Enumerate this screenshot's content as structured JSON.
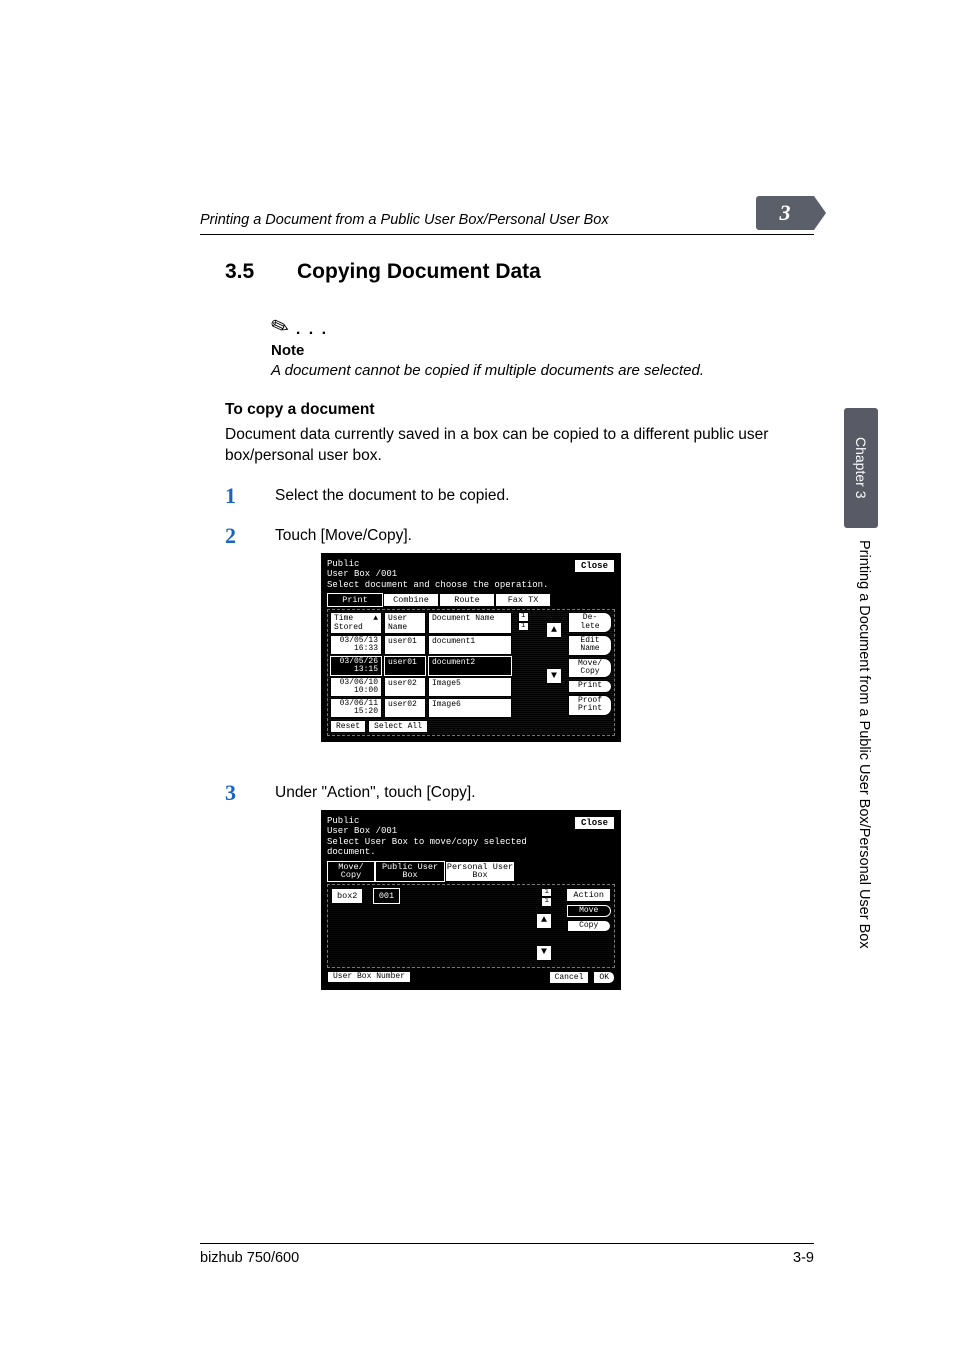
{
  "header": {
    "running": "Printing a Document from a Public User Box/Personal User Box",
    "chapter_badge": "3"
  },
  "side": {
    "chapter": "Chapter 3",
    "long": "Printing a Document from a Public User Box/Personal User Box"
  },
  "section": {
    "number": "3.5",
    "title": "Copying Document Data"
  },
  "note": {
    "label": "Note",
    "text": "A document cannot be copied if multiple documents are selected."
  },
  "sub": {
    "heading": "To copy a document",
    "intro": "Document data currently saved in a box can be copied to a different public user box/personal user box."
  },
  "steps": {
    "s1": {
      "n": "1",
      "t": "Select the document to be copied."
    },
    "s2": {
      "n": "2",
      "t": "Touch [Move/Copy]."
    },
    "s3": {
      "n": "3",
      "t": "Under \"Action\", touch [Copy]."
    }
  },
  "panel1": {
    "title_l1": "Public",
    "title_l2": "User Box   /001",
    "subtitle": "Select document and choose the operation.",
    "close": "Close",
    "tabs": {
      "print": "Print",
      "combine": "Combine",
      "route": "Route",
      "fax": "Fax TX"
    },
    "cols": {
      "time": "Time Stored",
      "sort_glyph": "▲",
      "user": "User Name",
      "doc": "Document Name"
    },
    "count": {
      "top": "1",
      "bot": "1"
    },
    "rows": [
      {
        "date": "03/05/13 16:33",
        "user": "user01",
        "doc": "document1"
      },
      {
        "date": "03/05/26 13:15",
        "user": "user01",
        "doc": "document2",
        "selected": true
      },
      {
        "date": "03/06/10 10:00",
        "user": "user02",
        "doc": "Image5"
      },
      {
        "date": "03/06/11 15:20",
        "user": "user02",
        "doc": "Image6"
      }
    ],
    "actions": {
      "delete": "De- lete",
      "edit": "Edit Name",
      "move": "Move/ Copy",
      "print": "Print",
      "proof": "Proof Print"
    },
    "footer": {
      "reset": "Reset",
      "selall": "Select All"
    }
  },
  "panel2": {
    "title_l1": "Public",
    "title_l2": "User Box   /001",
    "subtitle": "Select User Box to move/copy selected document.",
    "close": "Close",
    "tabs": {
      "movecopy": "Move/ Copy",
      "public": "Public User Box",
      "personal": "Personal User Box"
    },
    "items": {
      "box2": "box2",
      "b001": "001"
    },
    "count": {
      "top": "1",
      "bot": "1"
    },
    "right": {
      "action": "Action",
      "move": "Move",
      "copy": "Copy"
    },
    "bottom": {
      "userboxnum": "User Box Number",
      "cancel": "Cancel",
      "ok": "OK"
    }
  },
  "footer": {
    "left": "bizhub 750/600",
    "right": "3-9"
  }
}
